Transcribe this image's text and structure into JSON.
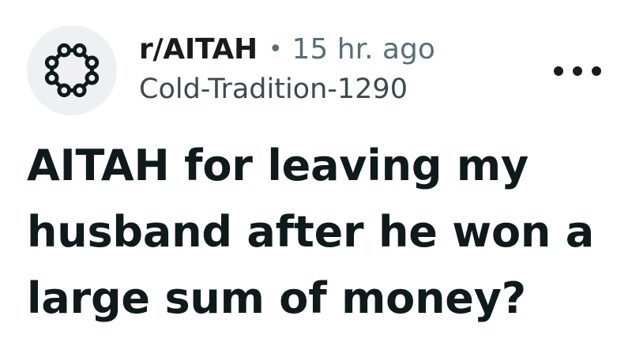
{
  "post": {
    "subreddit": "r/AITAH",
    "separator": "•",
    "time_ago": "15 hr. ago",
    "author": "Cold-Tradition-1290",
    "title": "AITAH for leaving my husband after he won a large sum of money?",
    "avatar_icon": "subreddit-community-icon",
    "more_icon": "more-options-icon"
  },
  "colors": {
    "text": "#1a1a1b",
    "muted": "#576f76",
    "avatar_bg": "#eef0f2"
  }
}
